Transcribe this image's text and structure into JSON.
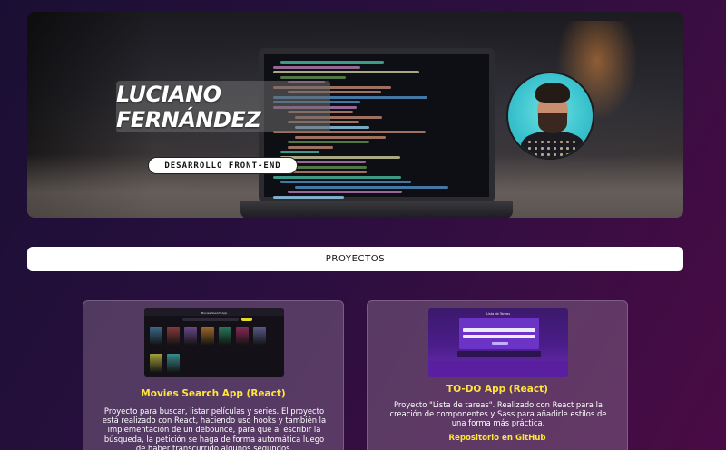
{
  "hero": {
    "name": "LUCIANO FERNÁNDEZ",
    "role": "DESARROLLO FRONT-END"
  },
  "projects_bar": {
    "label": "PROYECTOS"
  },
  "projects": [
    {
      "thumb_title": "Movies Search App",
      "title": "Movies Search App (React)",
      "description": "Proyecto para buscar, listar películas y series. El proyecto está realizado con React, haciendo uso hooks y también la implementación de un debounce, para que al escribir la búsqueda, la petición se haga de forma automática luego de haber transcurrido algunos segundos."
    },
    {
      "thumb_title": "Lista de Tareas",
      "title": "TO-DO App (React)",
      "description": "Proyecto \"Lista de tareas\". Realizado con React para la creación de componentes y Sass para añadirle estilos de una forma más práctica.",
      "link": "Repositorio en GitHub"
    }
  ],
  "colors": {
    "accent_yellow": "#ffe53b",
    "background_start": "#1a0f33",
    "background_end": "#4a0b45"
  }
}
